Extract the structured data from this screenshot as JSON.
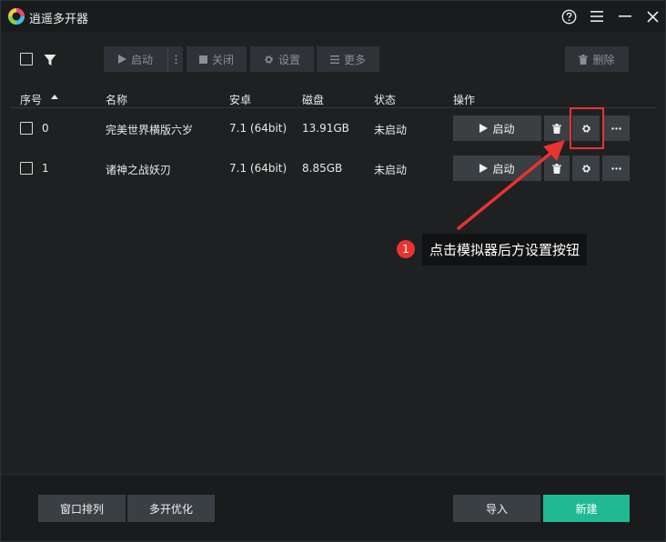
{
  "app": {
    "title": "逍遥多开器"
  },
  "toolbar": {
    "start_label": "启动",
    "close_label": "关闭",
    "settings_label": "设置",
    "more_label": "更多",
    "delete_label": "删除"
  },
  "table": {
    "headers": {
      "index": "序号",
      "name": "名称",
      "android": "安卓",
      "disk": "磁盘",
      "status": "状态",
      "actions": "操作"
    },
    "rows": [
      {
        "index": "0",
        "name": "完美世界横版六岁",
        "android": "7.1 (64bit)",
        "disk": "13.91GB",
        "status": "未启动",
        "start_label": "启动"
      },
      {
        "index": "1",
        "name": "诸神之战妖刃",
        "android": "7.1 (64bit)",
        "disk": "8.85GB",
        "status": "未启动",
        "start_label": "启动"
      }
    ]
  },
  "annotation": {
    "number": "1",
    "text": "点击模拟器后方设置按钮",
    "color": "#e8332f"
  },
  "footer": {
    "arrange_label": "窗口排列",
    "optimize_label": "多开优化",
    "import_label": "导入",
    "new_label": "新建"
  },
  "colors": {
    "accent": "#1fba94",
    "background": "#1e2022",
    "button": "#3a3f44"
  }
}
